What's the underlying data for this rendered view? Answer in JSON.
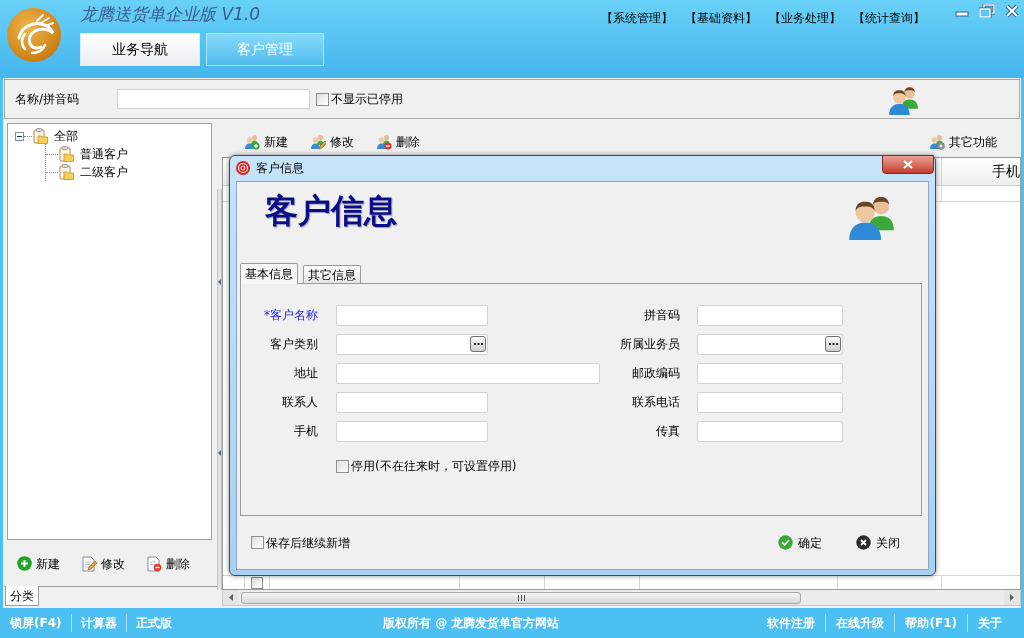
{
  "app": {
    "title": "龙腾送货单企业版 V1.0",
    "menu": [
      "【系统管理】",
      "【基础资料】",
      "【业务处理】",
      "【统计查询】"
    ],
    "tabs": [
      {
        "label": "业务导航",
        "selected": false
      },
      {
        "label": "客户管理",
        "selected": true
      }
    ]
  },
  "search": {
    "label": "名称/拼音码",
    "hide_disabled": {
      "label": "不显示已停用",
      "checked": false
    }
  },
  "category_panel": {
    "tree": [
      {
        "label": "全部",
        "expanded": true,
        "children": [
          {
            "label": "普通客户"
          },
          {
            "label": "二级客户"
          }
        ]
      }
    ],
    "buttons": [
      {
        "kind": "add",
        "label": "新建"
      },
      {
        "kind": "edit",
        "label": "修改"
      },
      {
        "kind": "delete",
        "label": "删除"
      }
    ],
    "tabs": [
      {
        "label": "分类",
        "selected": true
      }
    ]
  },
  "toolbar": {
    "buttons": [
      {
        "kind": "add",
        "label": "新建"
      },
      {
        "kind": "edit",
        "label": "修改"
      },
      {
        "kind": "delete",
        "label": "删除"
      }
    ],
    "more": {
      "kind": "more",
      "label": "其它功能"
    }
  },
  "table": {
    "columns": [
      {
        "label": "手机"
      }
    ],
    "footer": {
      "checked": false
    }
  },
  "dialog": {
    "title": "客户信息",
    "heading": "客户信息",
    "tabs": [
      {
        "label": "基本信息",
        "selected": true
      },
      {
        "label": "其它信息",
        "selected": false
      }
    ],
    "fields_left": [
      {
        "label": "*客户名称",
        "required": true,
        "kind": "text"
      },
      {
        "label": "客户类别",
        "required": false,
        "kind": "lookup"
      },
      {
        "label": "地址",
        "required": false,
        "kind": "wide"
      },
      {
        "label": "联系人",
        "required": false,
        "kind": "text"
      },
      {
        "label": "手机",
        "required": false,
        "kind": "text"
      }
    ],
    "fields_right": [
      {
        "label": "拼音码",
        "required": false,
        "kind": "text"
      },
      {
        "label": "所属业务员",
        "required": false,
        "kind": "lookup"
      },
      {
        "label": "邮政编码",
        "required": false,
        "kind": "text"
      },
      {
        "label": "联系电话",
        "required": false,
        "kind": "text"
      },
      {
        "label": "传真",
        "required": false,
        "kind": "text"
      }
    ],
    "disabled_check": {
      "label": "停用(不在往来时，可设置停用)",
      "checked": false
    },
    "keep_adding": {
      "label": "保存后继续新增",
      "checked": false
    },
    "buttons": [
      {
        "kind": "ok",
        "label": "确定"
      },
      {
        "kind": "close",
        "label": "关闭"
      }
    ]
  },
  "status_bar": {
    "left": [
      "锁屏(F4)",
      "计算器",
      "正式版"
    ],
    "center": "版权所有 @ 龙腾发货单官方网站",
    "right": [
      "软件注册",
      "在线升级",
      "帮助(F1)",
      "关于"
    ]
  }
}
